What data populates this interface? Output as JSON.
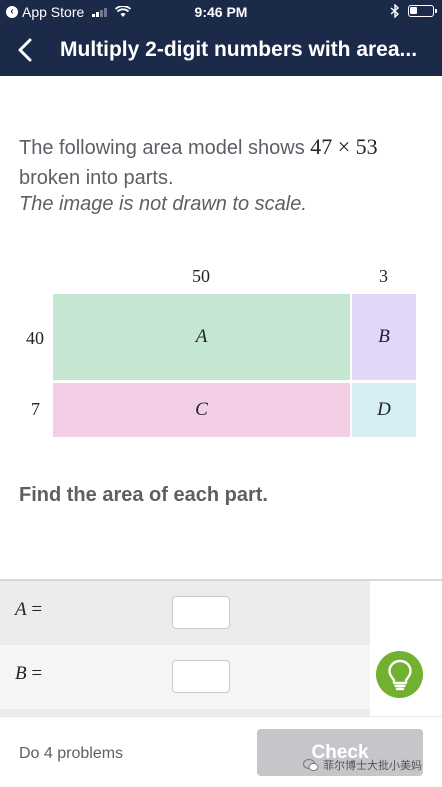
{
  "status_bar": {
    "back_app": "App Store",
    "time": "9:46 PM"
  },
  "nav": {
    "title": "Multiply 2-digit numbers with area..."
  },
  "question": {
    "text_before": "The following area model shows",
    "expression": "47 × 53",
    "text_after": "broken into parts.",
    "note": "The image is not drawn to scale."
  },
  "area_model": {
    "column_labels": [
      "50",
      "3"
    ],
    "row_labels": [
      "40",
      "7"
    ],
    "cells": [
      "A",
      "B",
      "C",
      "D"
    ],
    "colors": {
      "A": "#c5e6d1",
      "B": "#e0d7f9",
      "C": "#f2cfe6",
      "D": "#d6eff4"
    }
  },
  "prompt": "Find the area of each part.",
  "answers": [
    {
      "variable": "A",
      "value": ""
    },
    {
      "variable": "B",
      "value": ""
    }
  ],
  "footer": {
    "do_problems": "Do 4 problems",
    "check_label": "Check"
  },
  "hint_icon": "lightbulb-icon",
  "watermark": "菲尔博士大批小美妈",
  "theme": {
    "header_bg": "#1c2a4a",
    "hint_green": "#72b02f",
    "check_disabled": "#c4c6c9"
  }
}
